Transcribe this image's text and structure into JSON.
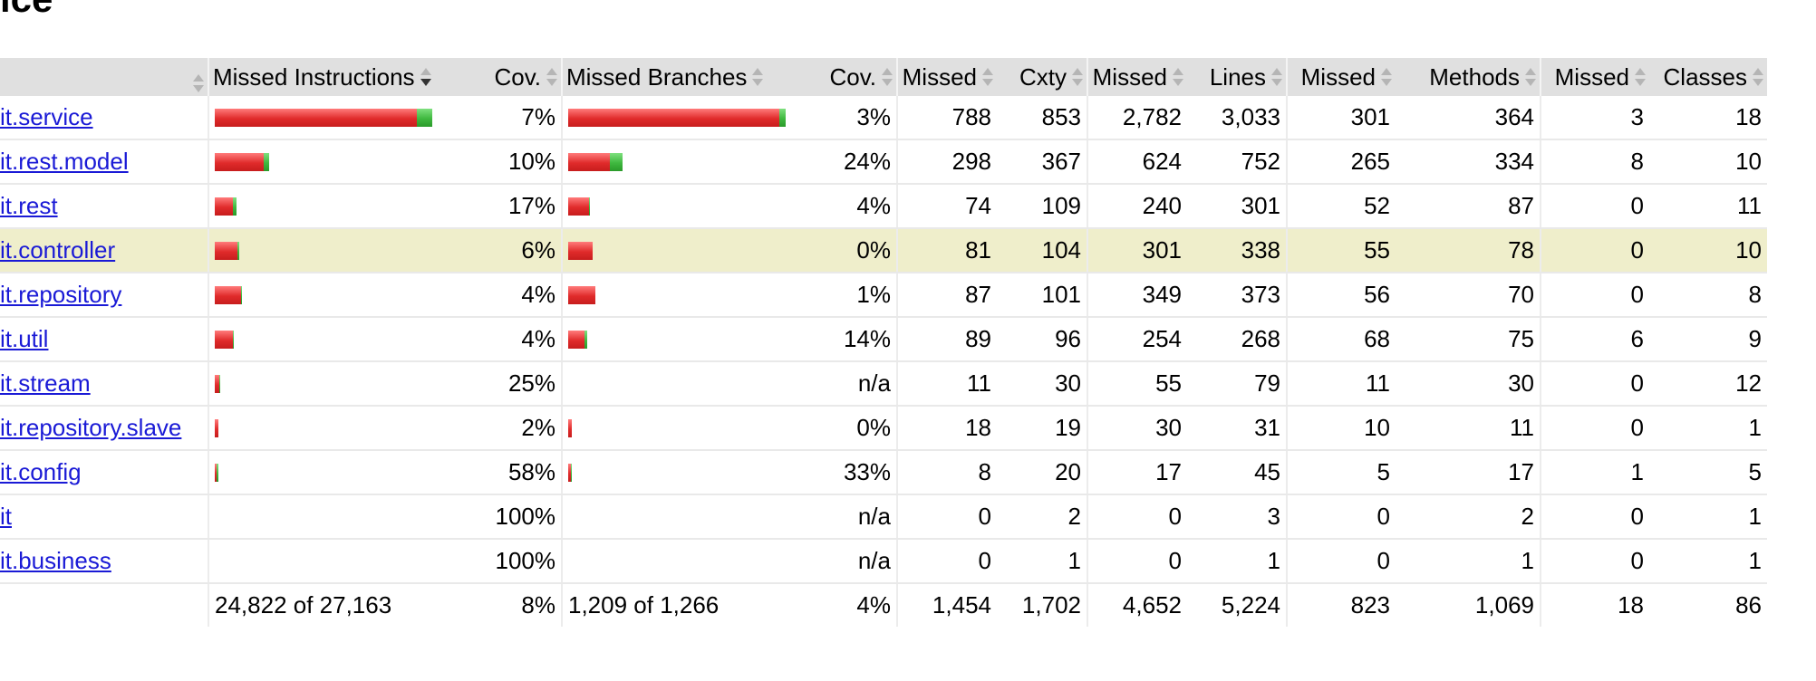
{
  "page": {
    "title": "ice"
  },
  "table": {
    "headers": {
      "element": "",
      "missed_instructions": "Missed Instructions",
      "instr_cov": "Cov.",
      "missed_branches": "Missed Branches",
      "branch_cov": "Cov.",
      "missed_cxty": "Missed",
      "cxty": "Cxty",
      "missed_lines": "Missed",
      "lines": "Lines",
      "missed_methods": "Missed",
      "methods": "Methods",
      "missed_classes": "Missed",
      "classes": "Classes"
    },
    "rows": [
      {
        "name": "it.service",
        "instr_missed_pct": 93,
        "instr_cov": "7%",
        "branch_missed_pct": 97,
        "branch_cov": "3%",
        "missed_cxty": "788",
        "cxty": "853",
        "missed_lines": "2,782",
        "lines": "3,033",
        "missed_methods": "301",
        "methods": "364",
        "missed_classes": "3",
        "classes": "18"
      },
      {
        "name": "it.rest.model",
        "instr_missed_pct": 90,
        "instr_cov": "10%",
        "branch_missed_pct": 76,
        "branch_cov": "24%",
        "missed_cxty": "298",
        "cxty": "367",
        "missed_lines": "624",
        "lines": "752",
        "missed_methods": "265",
        "methods": "334",
        "missed_classes": "8",
        "classes": "10"
      },
      {
        "name": "it.rest",
        "instr_missed_pct": 83,
        "instr_cov": "17%",
        "branch_missed_pct": 96,
        "branch_cov": "4%",
        "missed_cxty": "74",
        "cxty": "109",
        "missed_lines": "240",
        "lines": "301",
        "missed_methods": "52",
        "methods": "87",
        "missed_classes": "0",
        "classes": "11"
      },
      {
        "name": "it.controller",
        "instr_missed_pct": 94,
        "instr_cov": "6%",
        "branch_missed_pct": 100,
        "branch_cov": "0%",
        "missed_cxty": "81",
        "cxty": "104",
        "missed_lines": "301",
        "lines": "338",
        "missed_methods": "55",
        "methods": "78",
        "missed_classes": "0",
        "classes": "10"
      },
      {
        "name": "it.repository",
        "instr_missed_pct": 96,
        "instr_cov": "4%",
        "branch_missed_pct": 99,
        "branch_cov": "1%",
        "missed_cxty": "87",
        "cxty": "101",
        "missed_lines": "349",
        "lines": "373",
        "missed_methods": "56",
        "methods": "70",
        "missed_classes": "0",
        "classes": "8"
      },
      {
        "name": "it.util",
        "instr_missed_pct": 96,
        "instr_cov": "4%",
        "branch_missed_pct": 86,
        "branch_cov": "14%",
        "missed_cxty": "89",
        "cxty": "96",
        "missed_lines": "254",
        "lines": "268",
        "missed_methods": "68",
        "methods": "75",
        "missed_classes": "6",
        "classes": "9"
      },
      {
        "name": "it.stream",
        "instr_missed_pct": 75,
        "instr_cov": "25%",
        "branch_missed_pct": null,
        "branch_cov": "n/a",
        "missed_cxty": "11",
        "cxty": "30",
        "missed_lines": "55",
        "lines": "79",
        "missed_methods": "11",
        "methods": "30",
        "missed_classes": "0",
        "classes": "12"
      },
      {
        "name": "it.repository.slave",
        "instr_missed_pct": 98,
        "instr_cov": "2%",
        "branch_missed_pct": 100,
        "branch_cov": "0%",
        "missed_cxty": "18",
        "cxty": "19",
        "missed_lines": "30",
        "lines": "31",
        "missed_methods": "10",
        "methods": "11",
        "missed_classes": "0",
        "classes": "1"
      },
      {
        "name": "it.config",
        "instr_missed_pct": 42,
        "instr_cov": "58%",
        "branch_missed_pct": 67,
        "branch_cov": "33%",
        "missed_cxty": "8",
        "cxty": "20",
        "missed_lines": "17",
        "lines": "45",
        "missed_methods": "5",
        "methods": "17",
        "missed_classes": "1",
        "classes": "5"
      },
      {
        "name": "it",
        "instr_missed_pct": 0,
        "instr_cov": "100%",
        "branch_missed_pct": null,
        "branch_cov": "n/a",
        "missed_cxty": "0",
        "cxty": "2",
        "missed_lines": "0",
        "lines": "3",
        "missed_methods": "0",
        "methods": "2",
        "missed_classes": "0",
        "classes": "1"
      },
      {
        "name": "it.business",
        "instr_missed_pct": 0,
        "instr_cov": "100%",
        "branch_missed_pct": null,
        "branch_cov": "n/a",
        "missed_cxty": "0",
        "cxty": "1",
        "missed_lines": "0",
        "lines": "1",
        "missed_methods": "0",
        "methods": "1",
        "missed_classes": "0",
        "classes": "1"
      }
    ],
    "highlight_row": 3,
    "footer": {
      "instructions": "24,822 of 27,163",
      "instr_cov": "8%",
      "branches": "1,209 of 1,266",
      "branch_cov": "4%",
      "missed_cxty": "1,454",
      "cxty": "1,702",
      "missed_lines": "4,652",
      "lines": "5,224",
      "missed_methods": "823",
      "methods": "1,069",
      "missed_classes": "18",
      "classes": "86"
    }
  },
  "colors": {
    "missed": "#e02b2b",
    "covered": "#3fb83f",
    "highlight": "#efeecb",
    "link": "#1a1ad6"
  }
}
